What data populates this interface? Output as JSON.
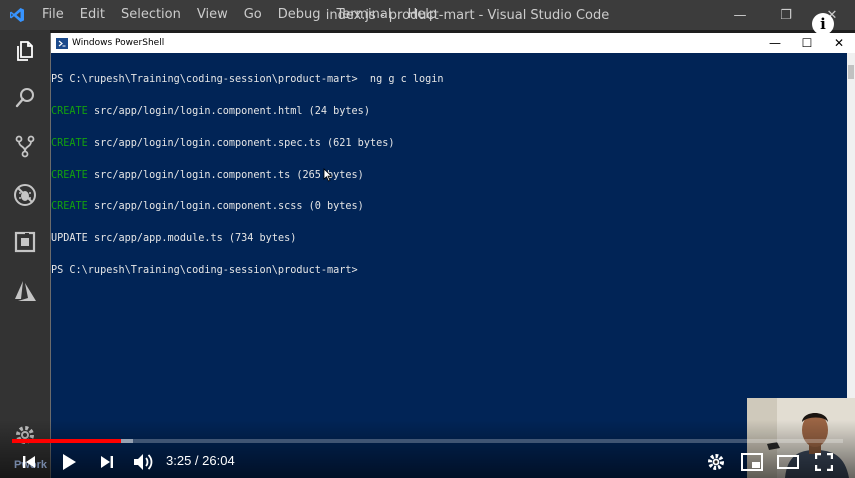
{
  "vscode": {
    "window_title": "index.js - product-mart - Visual Studio Code",
    "menu": [
      "File",
      "Edit",
      "Selection",
      "View",
      "Go",
      "Debug",
      "Terminal",
      "Help"
    ],
    "window_controls": {
      "minimize": "—",
      "restore": "❐",
      "close": "✕"
    },
    "activity_icons": [
      "explorer-icon",
      "search-icon",
      "source-control-icon",
      "debug-icon",
      "extensions-icon",
      "azure-icon",
      "settings-gear-icon"
    ]
  },
  "powershell": {
    "title": "Windows PowerShell",
    "controls": {
      "minimize": "—",
      "maximize": "☐",
      "close": "✕"
    },
    "lines": [
      {
        "kw": "",
        "text": "PS C:\\rupesh\\Training\\coding-session\\product-mart>  ng g c login"
      },
      {
        "kw": "CREATE",
        "text": " src/app/login/login.component.html (24 bytes)"
      },
      {
        "kw": "CREATE",
        "text": " src/app/login/login.component.spec.ts (621 bytes)"
      },
      {
        "kw": "CREATE",
        "text": " src/app/login/login.component.ts (265 bytes)"
      },
      {
        "kw": "CREATE",
        "text": " src/app/login/login.component.scss (0 bytes)"
      },
      {
        "kw": "UPDATE",
        "text": " src/app/app.module.ts (734 bytes)"
      },
      {
        "kw": "",
        "text": "PS C:\\rupesh\\Training\\coding-session\\product-mart>"
      }
    ]
  },
  "player": {
    "info_label": "i",
    "time_current": "3:25",
    "time_sep": " / ",
    "time_total": "26:04",
    "progress_played": 0.131,
    "progress_loaded": 0.146,
    "watermark": "Pwork",
    "colors": {
      "played": "#ff0000",
      "terminal_bg": "#012456",
      "create_kw": "#13a10e"
    }
  }
}
